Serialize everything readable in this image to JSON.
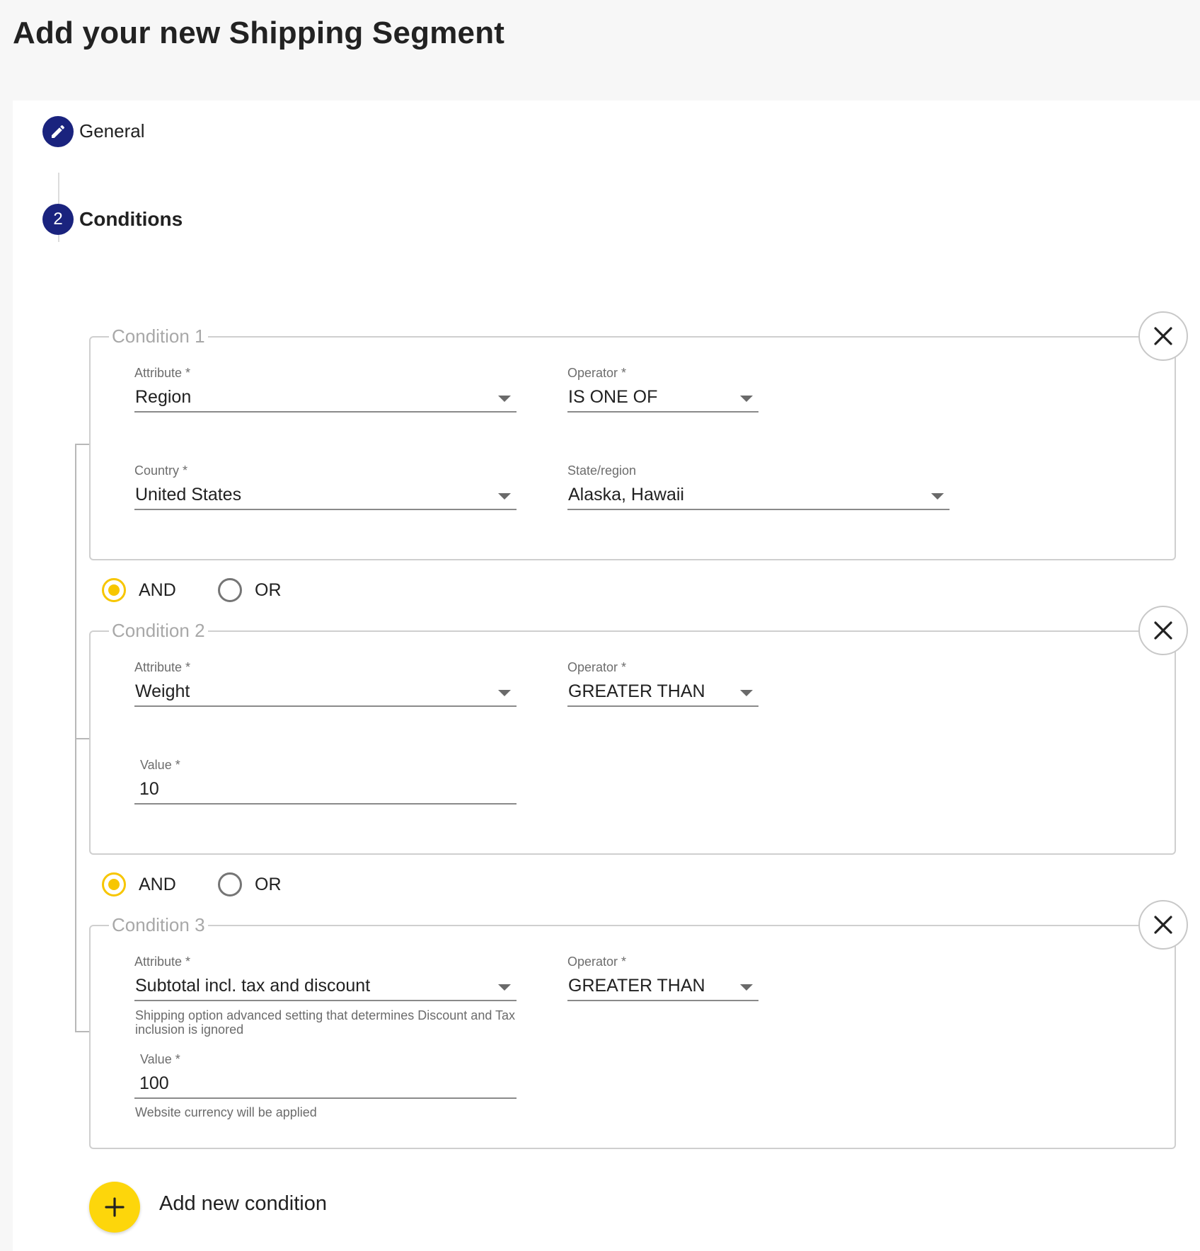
{
  "page": {
    "title": "Add your new Shipping Segment"
  },
  "stepper": {
    "steps": [
      {
        "label": "General",
        "icon": "pencil-icon"
      },
      {
        "number": "2",
        "label": "Conditions"
      }
    ]
  },
  "conditions": [
    {
      "legend": "Condition 1",
      "fields": [
        {
          "label": "Attribute *",
          "value": "Region"
        },
        {
          "label": "Operator *",
          "value": "IS ONE OF"
        },
        {
          "label": "Country *",
          "value": "United States"
        },
        {
          "label": "State/region",
          "value": "Alaska, Hawaii"
        }
      ]
    },
    {
      "legend": "Condition 2",
      "fields": [
        {
          "label": "Attribute *",
          "value": "Weight"
        },
        {
          "label": "Operator *",
          "value": "GREATER THAN"
        },
        {
          "label": "Value *",
          "value": "10"
        }
      ]
    },
    {
      "legend": "Condition 3",
      "fields": [
        {
          "label": "Attribute *",
          "value": "Subtotal incl. tax and discount",
          "hint": "Shipping option advanced setting that determines Discount and Tax inclusion is ignored"
        },
        {
          "label": "Operator *",
          "value": "GREATER THAN"
        },
        {
          "label": "Value *",
          "value": "100",
          "hint": "Website currency will be applied"
        }
      ]
    }
  ],
  "logic": [
    {
      "and_label": "AND",
      "or_label": "OR",
      "selected": "AND"
    },
    {
      "and_label": "AND",
      "or_label": "OR",
      "selected": "AND"
    }
  ],
  "add_condition": {
    "label": "Add new condition"
  },
  "colors": {
    "primary": "#1a237e",
    "accent": "#fdd60b",
    "radio": "#f7c600"
  }
}
